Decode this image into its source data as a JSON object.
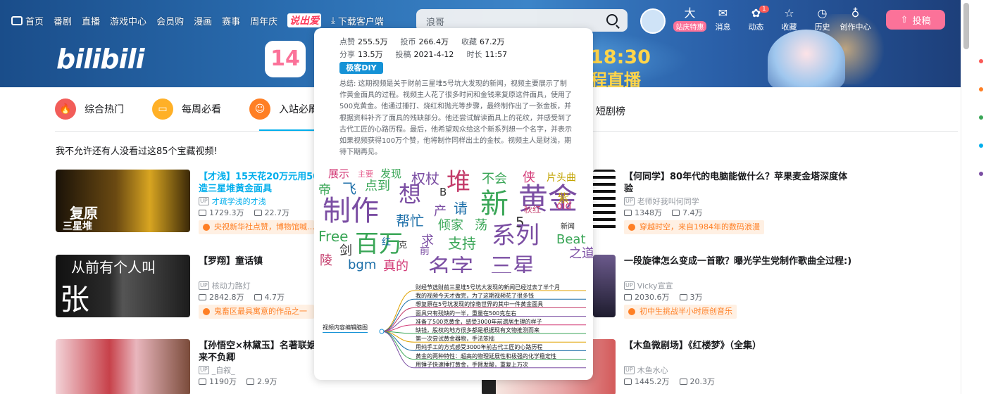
{
  "nav": {
    "home": "首页",
    "items": [
      "番剧",
      "直播",
      "游戏中心",
      "会员购",
      "漫画",
      "赛事",
      "周年庆"
    ],
    "event": "说出爱",
    "download": "下载客户端"
  },
  "search": {
    "placeholder": "浪哥"
  },
  "right_icons": [
    {
      "icon": "大",
      "label": "站庆特惠",
      "pink": true
    },
    {
      "icon": "✉",
      "label": "消息"
    },
    {
      "icon": "✿",
      "label": "动态",
      "badge": "1"
    },
    {
      "icon": "☆",
      "label": "收藏"
    },
    {
      "icon": "◷",
      "label": "历史"
    },
    {
      "icon": "♁",
      "label": "创作中心"
    }
  ],
  "upload_label": "投稿",
  "banner": {
    "logo": "bilibili",
    "badge": "14",
    "live_time": "18:30",
    "live_text": "程直播"
  },
  "tabs": [
    {
      "label": "综合热门",
      "color": "#f25d59",
      "icon": "🔥"
    },
    {
      "label": "每周必看",
      "color": "#ffb027",
      "icon": "▭"
    },
    {
      "label": "入站必刷",
      "color": "#ff7f24",
      "icon": "☺"
    }
  ],
  "tab_right": "短剧榜",
  "subtitle": "我不允许还有人没看过这85个宝藏视频!",
  "cards_left": [
    {
      "title": "【才浅】15天花20万元用50斤黄金打造三星堆黄金面具",
      "title_display_1": "【才浅】15天花20万元用50",
      "title_display_2": "造三星堆黄金面具",
      "blue": true,
      "up": "才疏学浅的才浅",
      "views": "1729.3万",
      "danmaku": "22.7万",
      "reason": "央视新华社点赞，博物馆喊…",
      "thumb_text1": "复原",
      "thumb_text2": "三星堆"
    },
    {
      "title": "【罗翔】童话镇",
      "up": "核动力路灯",
      "views": "2842.8万",
      "danmaku": "4.7万",
      "reason": "鬼畜区最具寓意的作品之一",
      "thumb_text1": "从前有个人叫",
      "thumb_text2": "张 三"
    },
    {
      "title_display_1": "【孙悟空×林黛玉】名著联姻",
      "title_display_2": "来不负卿",
      "up": "_自叙_",
      "views": "1190万",
      "danmaku": "2.9万"
    }
  ],
  "cards_right": [
    {
      "title_display_1": "【何同学】80年代的电脑能做什么？苹果麦金塔深度体",
      "title_display_2": "验",
      "up": "老师好我叫何同学",
      "views": "1348万",
      "danmaku": "7.4万",
      "reason": "穿越时空，来自1984年的数码浪漫"
    },
    {
      "title_display_1": "一段旋律怎么变成一首歌？曝光学生党制作歌曲全过程:)",
      "up": "Vicky宣宣",
      "views": "2030.6万",
      "danmaku": "3万",
      "reason": "初中生挑战半小时原创音乐"
    },
    {
      "title_display_1": "【木鱼微剧场】《红楼梦》（全集）",
      "up": "木鱼水心",
      "views": "1445.2万",
      "danmaku": "20.3万"
    }
  ],
  "popup": {
    "stats_row1": [
      {
        "k": "点赞",
        "v": "255.5万"
      },
      {
        "k": "投币",
        "v": "266.4万"
      },
      {
        "k": "收藏",
        "v": "67.2万"
      }
    ],
    "stats_row2": [
      {
        "k": "分享",
        "v": "13.5万"
      },
      {
        "k": "投稿",
        "v": "2021-4-12"
      },
      {
        "k": "时长",
        "v": "11:57"
      }
    ],
    "diy_label": "极客DIY",
    "summary": "总结: 这期视频是关于财前三星堆5号坑大发现的新闻，视频主要展示了制作黄金面具的过程。视频主人花了很多时间和金钱来复原这件面具，使用了500克黄金。他通过捶打、烧红和抛光等步骤，最终制作出了一张金板，并根据资料补齐了面具的残缺部分。他还尝试解读面具上的花纹，并感受到了古代工匠的心路历程。最后，他希望观众给这个新系列想一个名字，并表示如果视频获得100万个赞，他将制作同样出土的金杖。视频主人是财浅，期待下期再见。",
    "wordcloud": [
      {
        "t": "展示",
        "c": "#d33b77"
      },
      {
        "t": "主要",
        "c": "#e55b8c"
      },
      {
        "t": "发现",
        "c": "#3aa657"
      },
      {
        "t": "权杖",
        "c": "#7b4ea3"
      },
      {
        "t": "堆",
        "c": "#c33b6a"
      },
      {
        "t": "不会",
        "c": "#3aa657"
      },
      {
        "t": "侠",
        "c": "#d33b77"
      },
      {
        "t": "片头曲",
        "c": "#c2a300"
      },
      {
        "t": "帝",
        "c": "#3aa657"
      },
      {
        "t": "飞",
        "c": "#1b6ea8"
      },
      {
        "t": "点到",
        "c": "#3aa657"
      },
      {
        "t": "想",
        "c": "#7b4ea3"
      },
      {
        "t": "B",
        "c": "#333"
      },
      {
        "t": "新",
        "c": "#3aa657"
      },
      {
        "t": "黄金",
        "c": "#7b4ea3"
      },
      {
        "t": "制作",
        "c": "#7b4ea3"
      },
      {
        "t": "请",
        "c": "#1b6ea8"
      },
      {
        "t": "产",
        "c": "#7b4ea3"
      },
      {
        "t": "秋红",
        "c": "#c33b6a"
      },
      {
        "t": "old",
        "c": "#d33b77"
      },
      {
        "t": "帮忙",
        "c": "#1b6ea8"
      },
      {
        "t": "倾家",
        "c": "#3aa657"
      },
      {
        "t": "荡",
        "c": "#3aa657"
      },
      {
        "t": "5",
        "c": "#333"
      },
      {
        "t": "Free",
        "c": "#3aa657"
      },
      {
        "t": "百万",
        "c": "#3aa657"
      },
      {
        "t": "求",
        "c": "#7b4ea3"
      },
      {
        "t": "支持",
        "c": "#3aa657"
      },
      {
        "t": "系列",
        "c": "#7b4ea3"
      },
      {
        "t": "Beat",
        "c": "#3aa657"
      },
      {
        "t": "剑",
        "c": "#333"
      },
      {
        "t": "前",
        "c": "#7b4ea3"
      },
      {
        "t": "之道",
        "c": "#7b4ea3"
      },
      {
        "t": "陵",
        "c": "#c33b6a"
      },
      {
        "t": "bgm",
        "c": "#1b6ea8"
      },
      {
        "t": "真的",
        "c": "#d33b77"
      },
      {
        "t": "名字",
        "c": "#7b4ea3"
      },
      {
        "t": "三星",
        "c": "#7b4ea3"
      },
      {
        "t": "新闻",
        "c": "#333"
      },
      {
        "t": "红",
        "c": "#1b6ea8"
      },
      {
        "t": "克",
        "c": "#333"
      },
      {
        "t": "紫",
        "c": "#c2a300"
      }
    ],
    "mindmap_root": "视频内容编辑脑图",
    "mindmap_leaves": [
      "财经节选财前三星堆5号坑大发现的新闻已经过去了半个月",
      "我的视频今天才做完，为了这期视频花了很多钱",
      "想复原在5号坑发现的惊艳世界的其中一件黄金面具",
      "面具只有残缺的一半，重量在500克左右",
      "准备了500克黄金，感受3000年前遗居生理的样子",
      "缺钱，股权的地方很多都是根据现有文物推测而来",
      "第一次尝试黄金器物，手法笨拙",
      "用纯手工的方式感受3000年前古代工匠的心路历程",
      "黄金的两种特性：超高的物理延展性和极强的化学稳定性",
      "用锤子快速捶打黄金，手臂发酸，重复上万次"
    ]
  },
  "colors": {
    "accent": "#00aeec",
    "pink": "#fb7299",
    "orange": "#ff7f24"
  }
}
